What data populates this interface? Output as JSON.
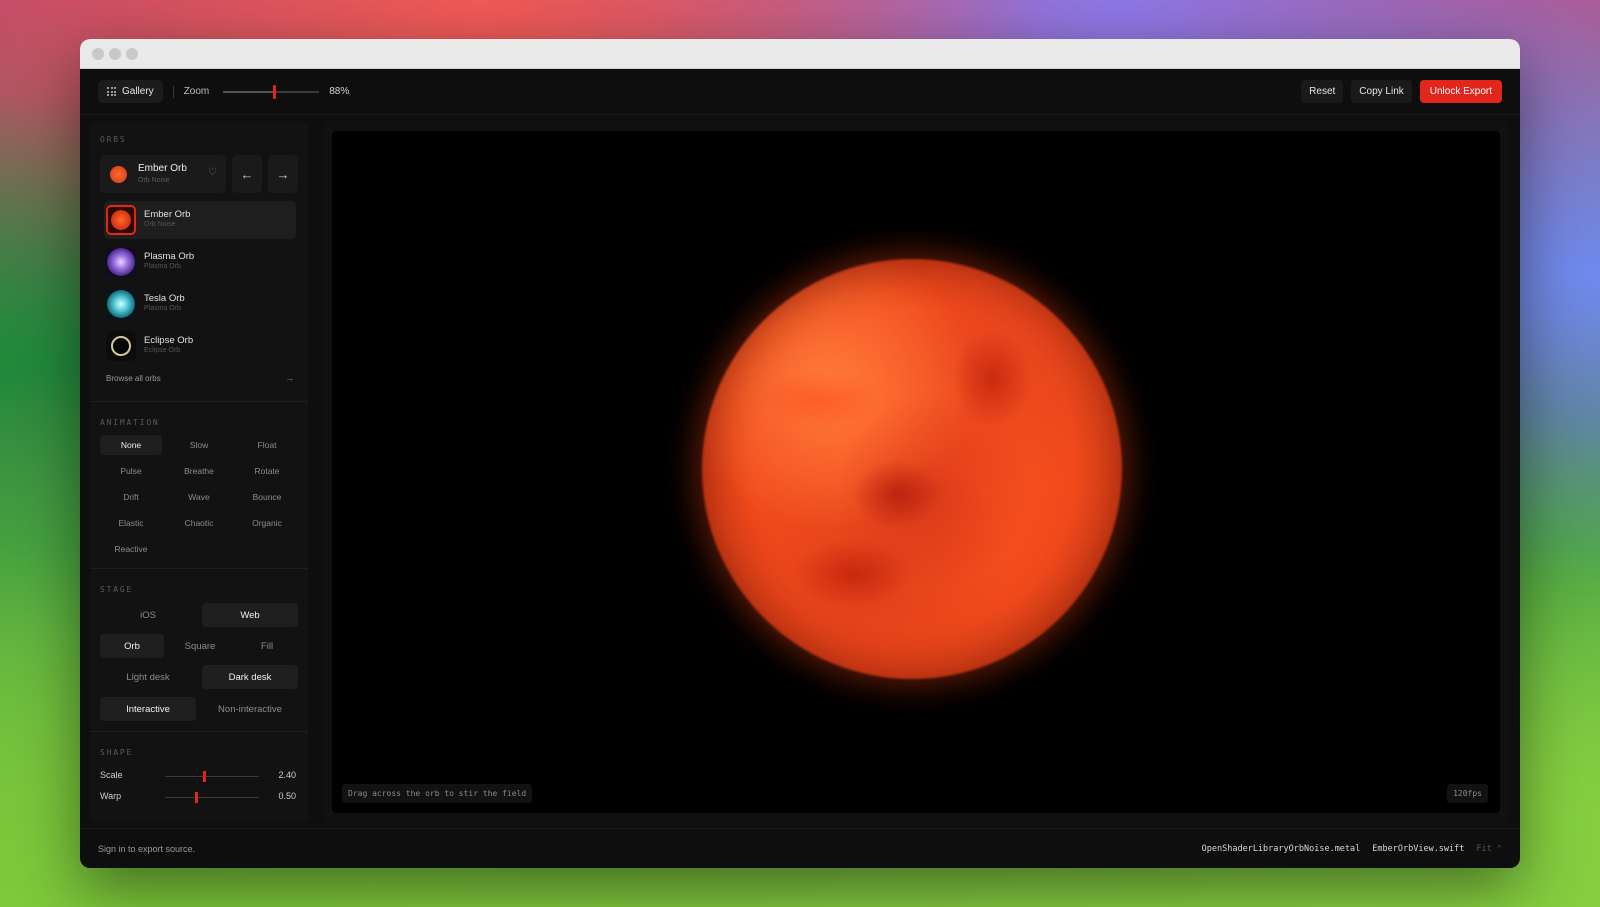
{
  "toolbar": {
    "gallery_label": "Gallery",
    "zoom_label": "Zoom",
    "zoom_value": "88%",
    "zoom_fraction": 0.53,
    "reset_label": "Reset",
    "copy_link_label": "Copy Link",
    "unlock_export_label": "Unlock Export"
  },
  "sidebar": {
    "orbs_heading": "ORBS",
    "current": {
      "name": "Ember Orb",
      "subtitle": "Orb Noise",
      "prev_icon": "←",
      "next_icon": "→",
      "heart_icon": "♡"
    },
    "items": [
      {
        "name": "Ember Orb",
        "subtitle": "Orb Noise"
      },
      {
        "name": "Plasma Orb",
        "subtitle": "Plasma Orb"
      },
      {
        "name": "Tesla Orb",
        "subtitle": "Plasma Orb"
      },
      {
        "name": "Eclipse Orb",
        "subtitle": "Eclipse Orb"
      }
    ],
    "browse_label": "Browse all orbs",
    "browse_arrow": "→",
    "animation_heading": "ANIMATION",
    "animations": [
      "None",
      "Slow",
      "Float",
      "Pulse",
      "Breathe",
      "Rotate",
      "Drift",
      "Wave",
      "Bounce",
      "Elastic",
      "Chaotic",
      "Organic",
      "Reactive"
    ],
    "animation_selected": "None",
    "stage_heading": "STAGE",
    "platform": [
      "iOS",
      "Web"
    ],
    "platform_selected": "Web",
    "shape_mode": [
      "Orb",
      "Square",
      "Fill"
    ],
    "shape_mode_selected": "Orb",
    "desk": [
      "Light desk",
      "Dark desk"
    ],
    "desk_selected": "Dark desk",
    "interaction": [
      "Interactive",
      "Non-interactive"
    ],
    "interaction_selected": "Interactive",
    "shape_heading": "SHAPE",
    "scale": {
      "label": "Scale",
      "value": "2.40",
      "fraction": 0.42
    },
    "warp": {
      "label": "Warp",
      "value": "0.50",
      "fraction": 0.33
    }
  },
  "stage": {
    "hint": "Drag across the orb to stir the field",
    "fps": "120fps"
  },
  "footer": {
    "signin": "Sign in to export source.",
    "file1": "OpenShaderLibraryOrbNoise.metal",
    "file2": "EmberOrbView.swift",
    "fit": "Fit ⌃"
  },
  "colors": {
    "accent": "#e3261c",
    "window_bg": "#0e0e0e",
    "panel_bg": "#121212"
  },
  "icons": [
    "grid-icon",
    "heart-icon",
    "arrow-left-icon",
    "arrow-right-icon",
    "arrow-right-icon"
  ]
}
